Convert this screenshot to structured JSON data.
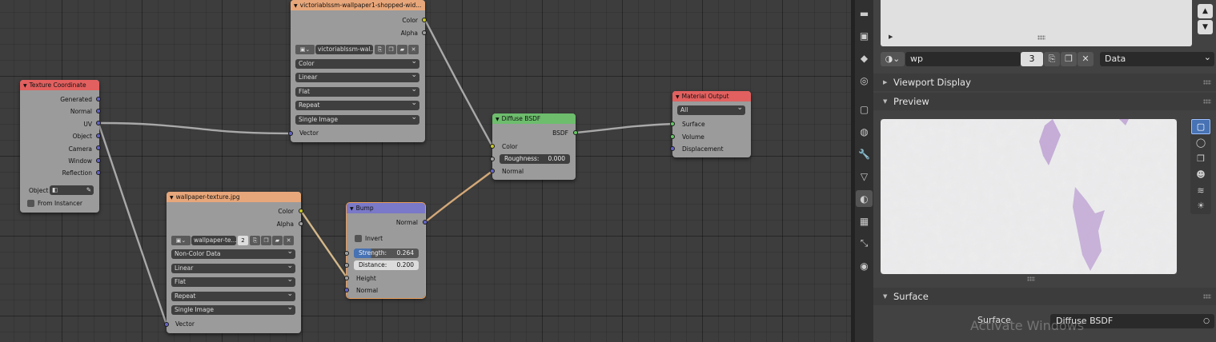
{
  "node_editor": {
    "texture_coordinate": {
      "title": "Texture Coordinate",
      "outputs": [
        "Generated",
        "Normal",
        "UV",
        "Object",
        "Camera",
        "Window",
        "Reflection"
      ],
      "object_label": "Object",
      "from_instancer": "From Instancer"
    },
    "image_top": {
      "title": "victoriablssm-wallpaper1-shopped-wid...",
      "outputs": [
        "Color",
        "Alpha"
      ],
      "image_name": "victoriablssm-wal...",
      "options": [
        "Color",
        "Linear",
        "Flat",
        "Repeat",
        "Single Image"
      ],
      "input": "Vector"
    },
    "image_bottom": {
      "title": "wallpaper-texture.jpg",
      "outputs": [
        "Color",
        "Alpha"
      ],
      "image_name": "wallpaper-te...",
      "users": "2",
      "options": [
        "Non-Color Data",
        "Linear",
        "Flat",
        "Repeat",
        "Single Image"
      ],
      "input": "Vector"
    },
    "bump": {
      "title": "Bump",
      "output": "Normal",
      "invert": "Invert",
      "strength_label": "Strength:",
      "strength": "0.264",
      "distance_label": "Distance:",
      "distance": "0.200",
      "inputs": [
        "Height",
        "Normal"
      ]
    },
    "diffuse": {
      "title": "Diffuse BSDF",
      "output": "BSDF",
      "inputs": [
        "Color",
        "Normal"
      ],
      "roughness_label": "Roughness:",
      "roughness": "0.000"
    },
    "material_output": {
      "title": "Material Output",
      "target": "All",
      "inputs": [
        "Surface",
        "Volume",
        "Displacement"
      ]
    },
    "colors": {
      "texture_header": "#e2605f",
      "image_header": "#e8a77a",
      "bump_header": "#7a78c8",
      "shader_header": "#6dbd6d",
      "output_header": "#e2605f"
    }
  },
  "properties": {
    "material_name": "wp",
    "users": "3",
    "link_mode": "Data",
    "panels": {
      "viewport_display": "Viewport Display",
      "preview": "Preview",
      "surface": "Surface"
    },
    "surface_label": "Surface",
    "surface_value": "Diffuse BSDF",
    "tabs": [
      "render-icon",
      "output-icon",
      "view-layer-icon",
      "scene-icon",
      "world-icon",
      "object-icon",
      "physics-icon",
      "modifier-icon",
      "particles-icon",
      "object-data-icon",
      "material-icon",
      "texture-icon",
      "constraints-icon",
      "physics-icon"
    ],
    "preview_shapes": [
      "plane-icon",
      "sphere-icon",
      "cube-icon",
      "monkey-icon",
      "hair-icon",
      "world-sphere-icon"
    ]
  },
  "watermark": "Activate Windows"
}
